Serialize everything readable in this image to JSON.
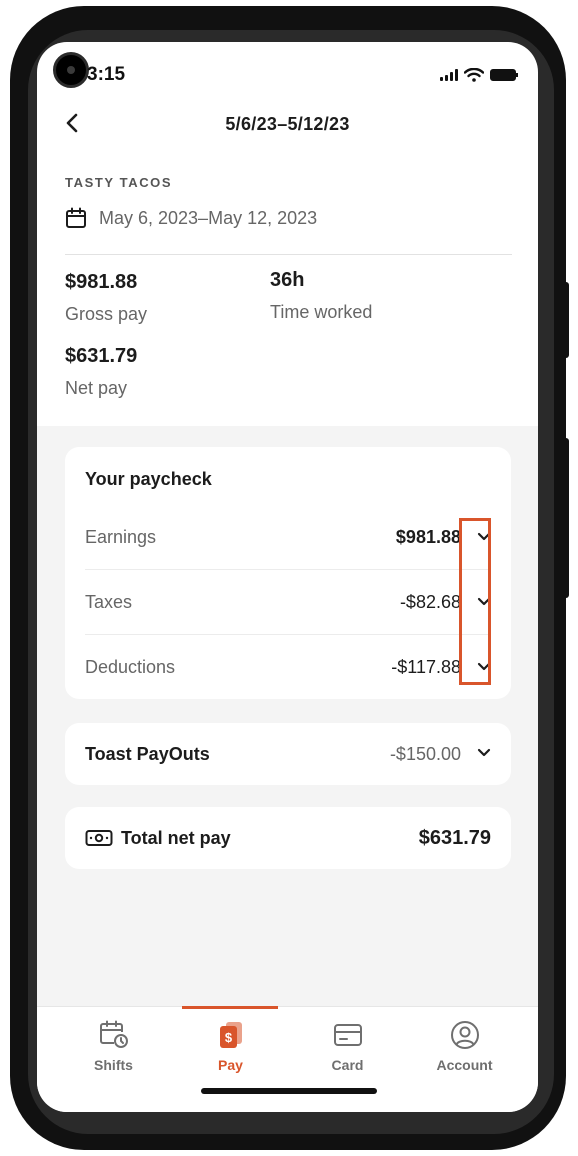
{
  "status_bar": {
    "time": "3:15"
  },
  "header": {
    "title": "5/6/23–5/12/23"
  },
  "summary": {
    "restaurant": "TASTY TACOS",
    "date_range": "May 6, 2023–May 12, 2023",
    "gross_pay_value": "$981.88",
    "gross_pay_label": "Gross pay",
    "time_worked_value": "36h",
    "time_worked_label": "Time worked",
    "net_pay_value": "$631.79",
    "net_pay_label": "Net pay"
  },
  "paycheck": {
    "title": "Your paycheck",
    "rows": [
      {
        "label": "Earnings",
        "amount": "$981.88"
      },
      {
        "label": "Taxes",
        "amount": "-$82.68"
      },
      {
        "label": "Deductions",
        "amount": "-$117.88"
      }
    ]
  },
  "payouts": {
    "title": "Toast PayOuts",
    "amount": "-$150.00"
  },
  "total": {
    "title": "Total net pay",
    "amount": "$631.79"
  },
  "bottom_nav": {
    "active": "Pay",
    "items": [
      {
        "label": "Shifts",
        "icon": "calendar-clock-icon"
      },
      {
        "label": "Pay",
        "icon": "pay-icon"
      },
      {
        "label": "Card",
        "icon": "card-icon"
      },
      {
        "label": "Account",
        "icon": "account-icon"
      }
    ]
  },
  "colors": {
    "accent": "#d9552b",
    "highlight_box": "#d9552b",
    "background_grey": "#f4f4f4"
  }
}
